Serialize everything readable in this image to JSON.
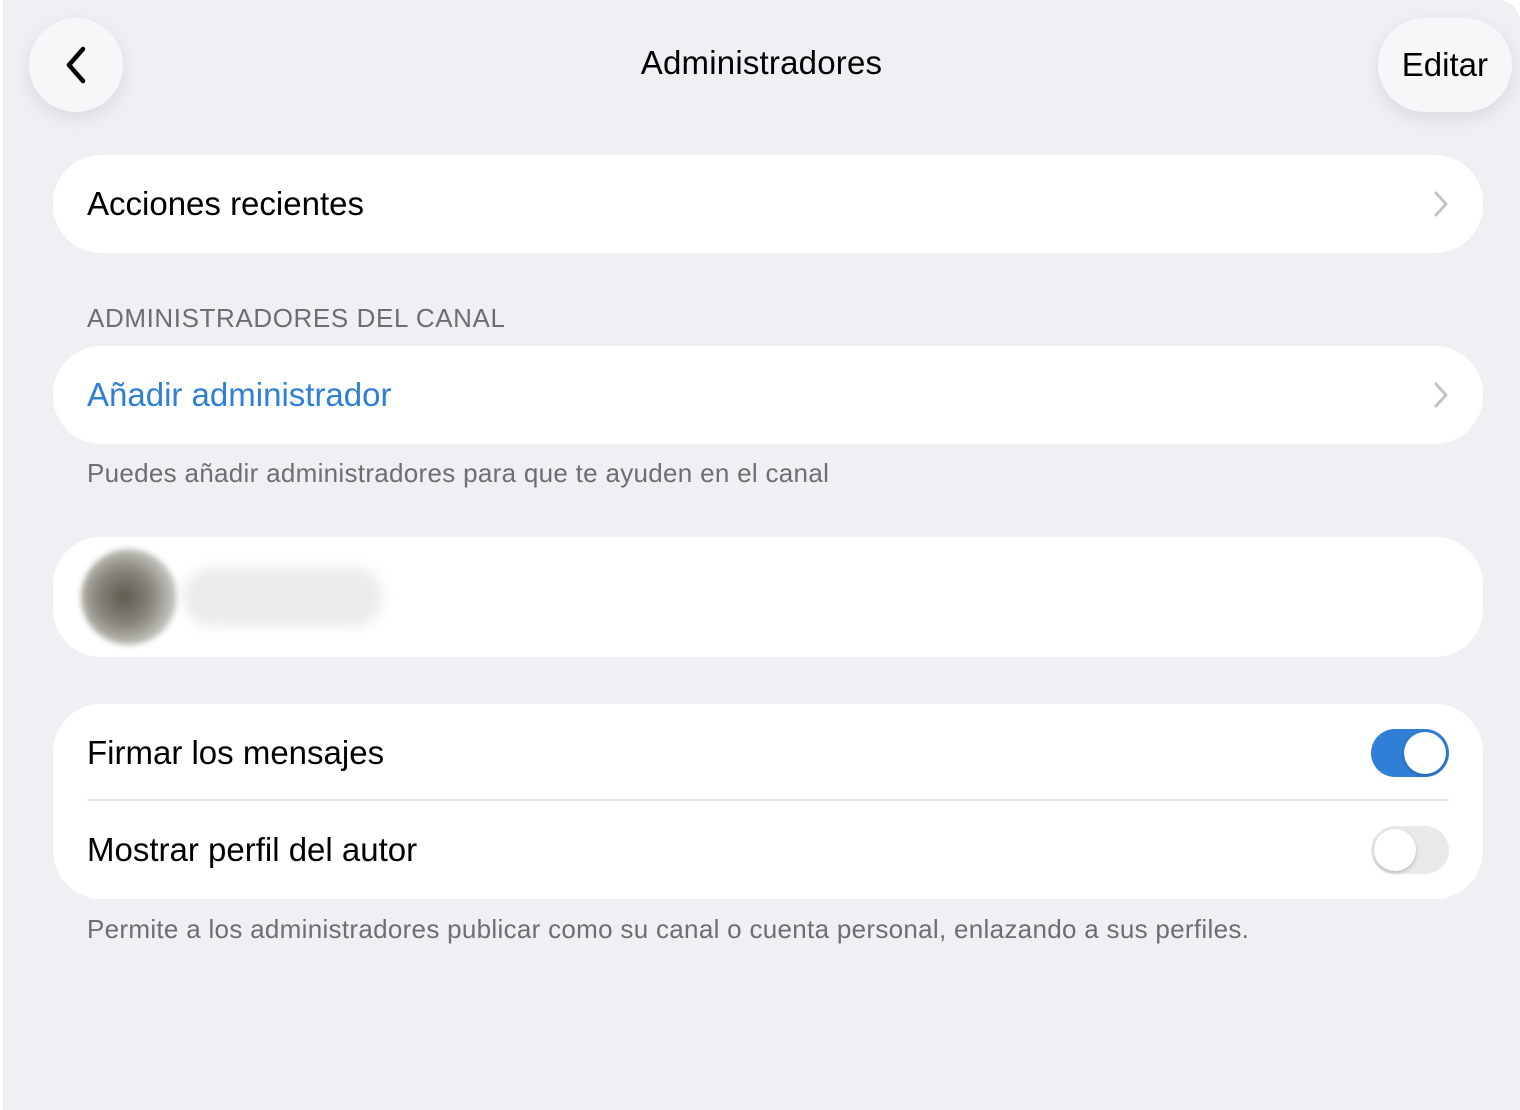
{
  "header": {
    "title": "Administradores",
    "edit_label": "Editar"
  },
  "recent_actions": {
    "label": "Acciones recientes"
  },
  "admins_section": {
    "header": "ADMINISTRADORES DEL CANAL",
    "add_admin_label": "Añadir administrador",
    "footer": "Puedes añadir administradores para que te ayuden en el canal"
  },
  "signatures": {
    "sign_messages_label": "Firmar los mensajes",
    "sign_messages_on": true,
    "show_author_label": "Mostrar perfil del autor",
    "show_author_on": false,
    "footer": "Permite a los administradores publicar como su canal o cuenta personal, enlazando a sus perfiles."
  },
  "colors": {
    "accent": "#2f7fd6",
    "background": "#efeff4",
    "secondary_text": "#6d6d72"
  }
}
